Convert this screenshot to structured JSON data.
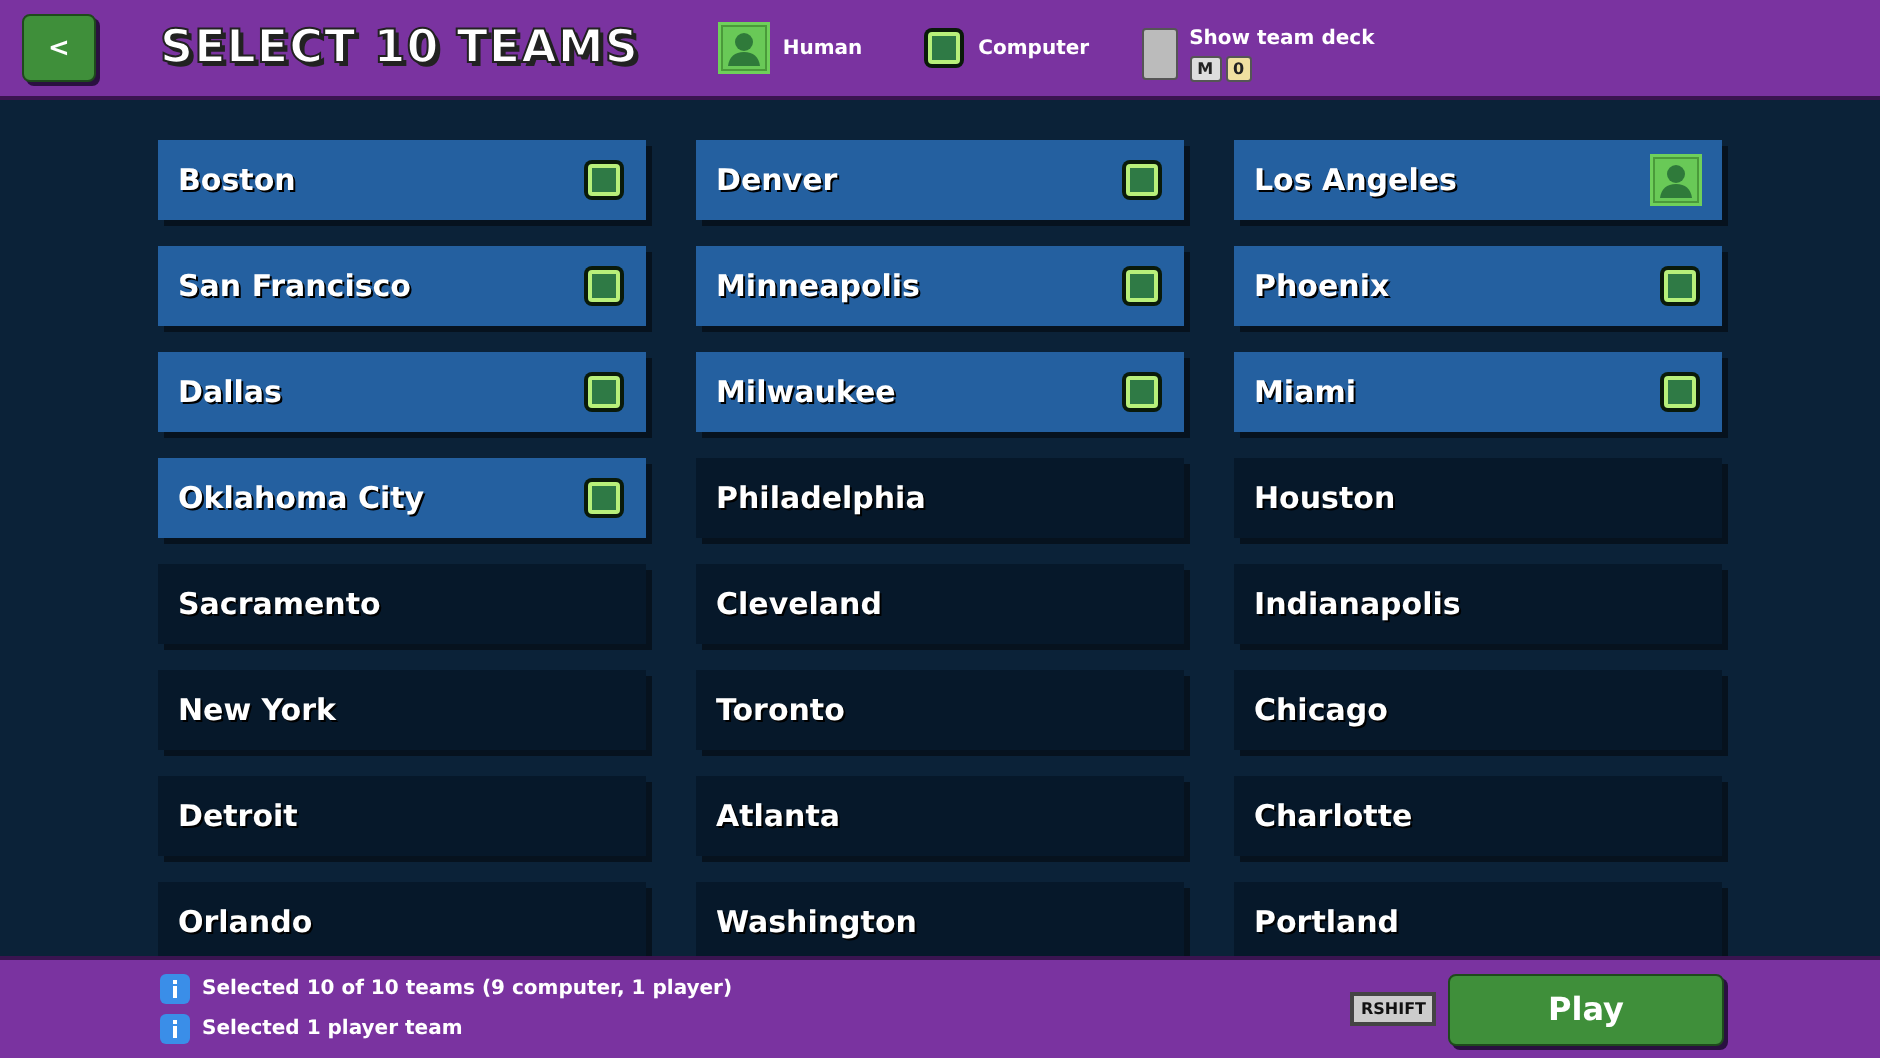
{
  "header": {
    "back": "<",
    "title": "SELECT 10 TEAMS",
    "legend": [
      {
        "kind": "human",
        "label": "Human"
      },
      {
        "kind": "computer",
        "label": "Computer"
      }
    ],
    "deck": {
      "label": "Show team deck",
      "checked": false,
      "keys": [
        "M",
        "0"
      ]
    }
  },
  "teams": [
    {
      "name": "Boston",
      "kind": "computer"
    },
    {
      "name": "Denver",
      "kind": "computer"
    },
    {
      "name": "Los Angeles",
      "kind": "human"
    },
    {
      "name": "San Francisco",
      "kind": "computer"
    },
    {
      "name": "Minneapolis",
      "kind": "computer"
    },
    {
      "name": "Phoenix",
      "kind": "computer"
    },
    {
      "name": "Dallas",
      "kind": "computer"
    },
    {
      "name": "Milwaukee",
      "kind": "computer"
    },
    {
      "name": "Miami",
      "kind": "computer"
    },
    {
      "name": "Oklahoma City",
      "kind": "computer"
    },
    {
      "name": "Philadelphia",
      "kind": "open"
    },
    {
      "name": "Houston",
      "kind": "open"
    },
    {
      "name": "Sacramento",
      "kind": "open"
    },
    {
      "name": "Cleveland",
      "kind": "open"
    },
    {
      "name": "Indianapolis",
      "kind": "open"
    },
    {
      "name": "New York",
      "kind": "open"
    },
    {
      "name": "Toronto",
      "kind": "open"
    },
    {
      "name": "Chicago",
      "kind": "open"
    },
    {
      "name": "Detroit",
      "kind": "open"
    },
    {
      "name": "Atlanta",
      "kind": "open"
    },
    {
      "name": "Charlotte",
      "kind": "open"
    },
    {
      "name": "Orlando",
      "kind": "open"
    },
    {
      "name": "Washington",
      "kind": "open"
    },
    {
      "name": "Portland",
      "kind": "open"
    }
  ],
  "footer": {
    "messages": [
      "Selected 10 of 10 teams (9 computer, 1 player)",
      "Selected 1 player team"
    ],
    "key_hint": "RSHIFT",
    "play": "Play"
  }
}
